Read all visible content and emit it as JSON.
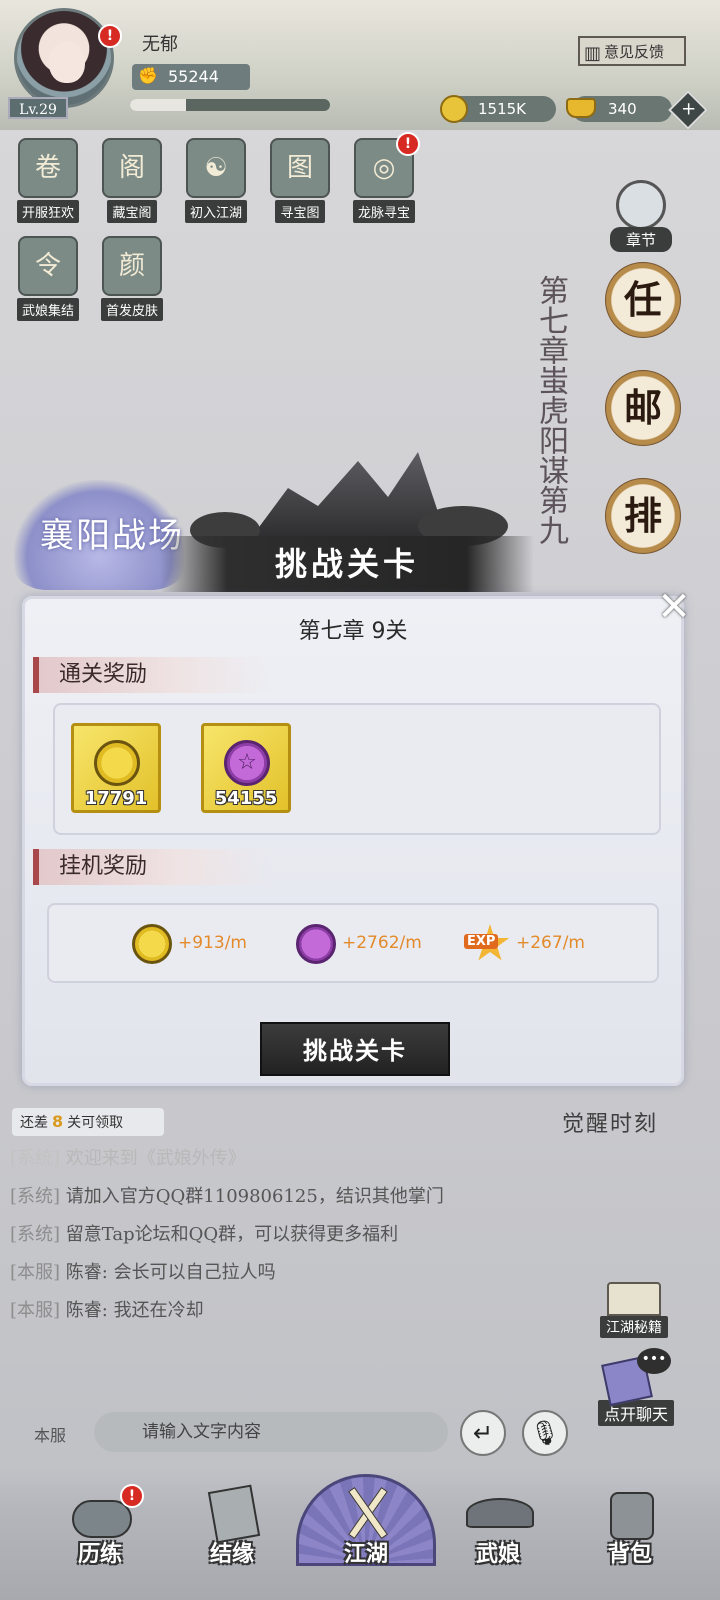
{
  "player": {
    "name": "无郁",
    "level": "Lv.29",
    "power": "55244",
    "exp_fraction": 0.28
  },
  "header": {
    "feedback_label": "意见反馈",
    "coins": "1515K",
    "gold": "340"
  },
  "features": [
    {
      "label": "开服狂欢",
      "icon": "scroll-icon",
      "glyph": "卷",
      "alert": false
    },
    {
      "label": "藏宝阁",
      "icon": "pavilion-icon",
      "glyph": "阁",
      "alert": false
    },
    {
      "label": "初入江湖",
      "icon": "taiji-icon",
      "glyph": "☯",
      "alert": false
    },
    {
      "label": "寻宝图",
      "icon": "treasure-map-icon",
      "glyph": "图",
      "alert": false
    },
    {
      "label": "龙脉寻宝",
      "icon": "compass-icon",
      "glyph": "◎",
      "alert": true
    },
    {
      "label": "武娘集结",
      "icon": "token-icon",
      "glyph": "令",
      "alert": false
    },
    {
      "label": "首发皮肤",
      "icon": "character-portrait-icon",
      "glyph": "颜",
      "alert": false
    }
  ],
  "chapter_side": {
    "label": "章节",
    "vertical_title": "第七章蚩虎阳谋第九",
    "characters": [
      "任",
      "邮",
      "排"
    ]
  },
  "scene": {
    "location_text": "襄阳战场",
    "banner_label": "挑战关卡"
  },
  "modal": {
    "title": "第七章  9关",
    "clear_reward_heading": "通关奖励",
    "clear_rewards": [
      {
        "icon": "coin-icon",
        "count": "17791"
      },
      {
        "icon": "pentagram-orb-icon",
        "count": "54155"
      }
    ],
    "idle_reward_heading": "挂机奖励",
    "idle_rewards": [
      {
        "icon": "coin-icon",
        "rate": "+913/m"
      },
      {
        "icon": "pentagram-orb-icon",
        "rate": "+2762/m"
      },
      {
        "icon": "exp-star-icon",
        "rate": "+267/m",
        "badge": "EXP"
      }
    ],
    "challenge_button": "挑战关卡",
    "close_glyph": "✕"
  },
  "progress": {
    "prefix": "还差",
    "count": "8",
    "suffix": "关可领取"
  },
  "awaken_text": "觉醒时刻",
  "chat": [
    {
      "tag": "[系统]",
      "text": "欢迎来到《武娘外传》",
      "faded": true
    },
    {
      "tag": "[系统]",
      "text": "请加入官方QQ群1109806125，结识其他掌门",
      "faded": false
    },
    {
      "tag": "[系统]",
      "text": "留意Tap论坛和QQ群，可以获得更多福利",
      "faded": false
    },
    {
      "tag": "[本服]",
      "text": "陈睿: 会长可以自己拉人吗",
      "faded": false
    },
    {
      "tag": "[本服]",
      "text": "陈睿: 我还在冷却",
      "faded": false
    }
  ],
  "side_buttons": {
    "secrets": "江湖秘籍",
    "open_chat": "点开聊天"
  },
  "chat_input": {
    "channel": "本服",
    "placeholder": "请输入文字内容"
  },
  "nav": [
    {
      "label": "历练",
      "icon": "cloud-training-icon",
      "alert": true
    },
    {
      "label": "结缘",
      "icon": "bond-card-icon",
      "alert": false
    },
    {
      "label": "江湖",
      "icon": "crossed-swords-icon",
      "alert": false
    },
    {
      "label": "武娘",
      "icon": "straw-hat-icon",
      "alert": false
    },
    {
      "label": "背包",
      "icon": "bag-icon",
      "alert": false
    }
  ],
  "colors": {
    "accent_orange": "#e38a2a",
    "alert_red": "#d62a22",
    "section_red": "#a8484b"
  }
}
